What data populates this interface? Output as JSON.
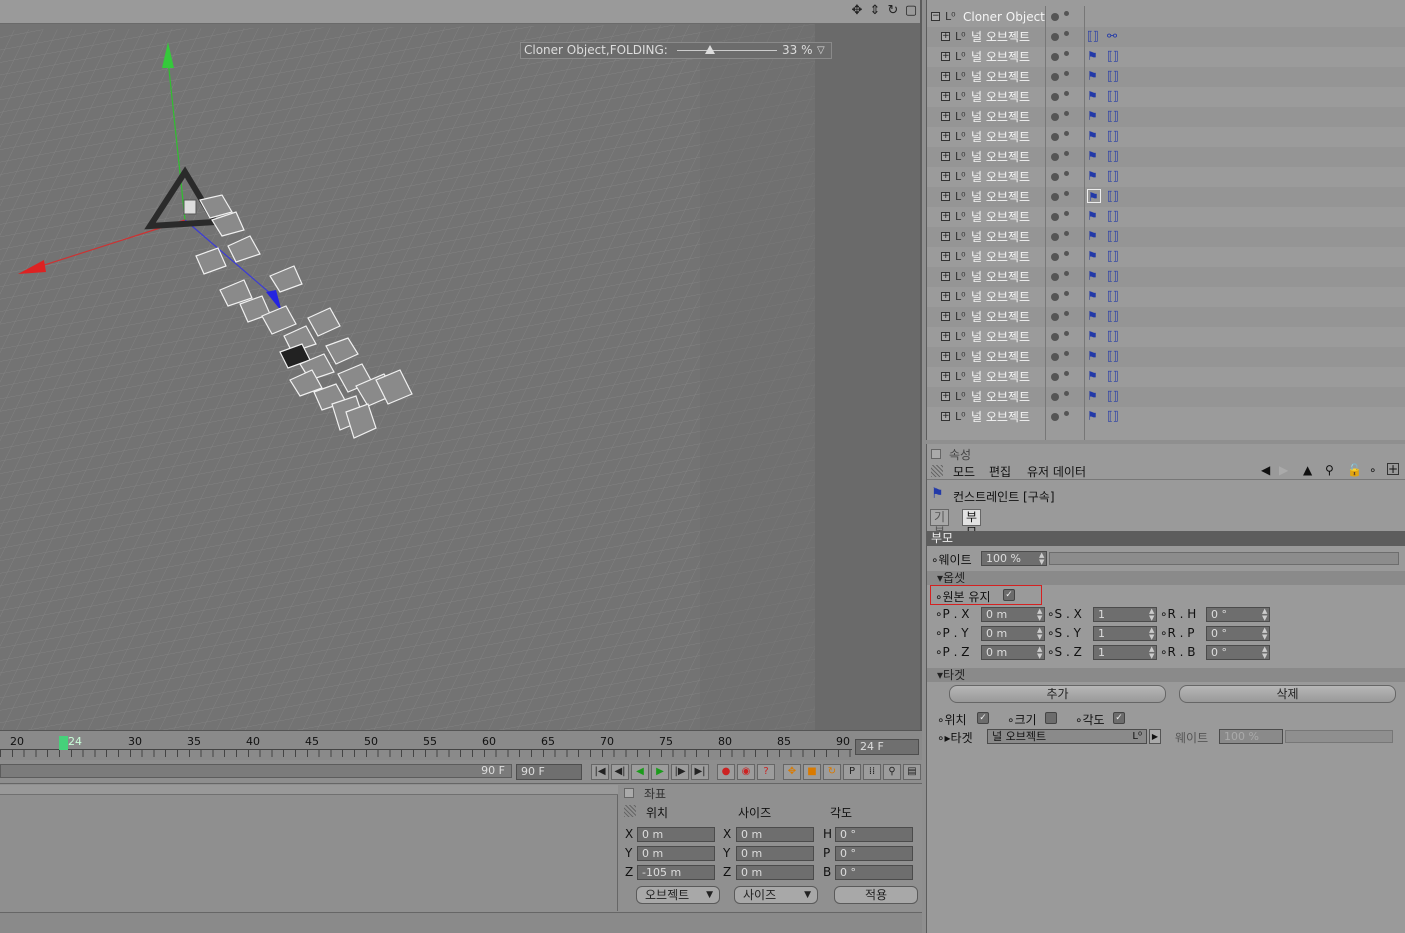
{
  "viewport": {
    "hud_label": "Cloner Object,FOLDING:",
    "hud_value": "33 %",
    "toolbar_icons": [
      "move-view-icon",
      "pan-view-icon",
      "rotate-view-icon",
      "maximize-view-icon"
    ]
  },
  "timeline": {
    "ticks": [
      "20",
      "24",
      "30",
      "35",
      "40",
      "45",
      "50",
      "55",
      "60",
      "65",
      "70",
      "75",
      "80",
      "85",
      "90"
    ],
    "fps": "24 F",
    "range_end_label": "90 F",
    "end_frame": "90 F",
    "current_frame": 24
  },
  "coords": {
    "title": "좌표",
    "headers": {
      "position": "위치",
      "size": "사이즈",
      "rotation": "각도"
    },
    "rows": [
      {
        "axis": "X",
        "pos": "0 m",
        "size_axis": "X",
        "size": "0 m",
        "rot_axis": "H",
        "rot": "0 °"
      },
      {
        "axis": "Y",
        "pos": "0 m",
        "size_axis": "Y",
        "size": "0 m",
        "rot_axis": "P",
        "rot": "0 °"
      },
      {
        "axis": "Z",
        "pos": "-105 m",
        "size_axis": "Z",
        "size": "0 m",
        "rot_axis": "B",
        "rot": "0 °"
      }
    ],
    "mode_dropdown": "오브젝트",
    "size_dropdown": "사이즈",
    "apply_button": "적용"
  },
  "objmgr": {
    "root_name": "Cloner Object",
    "child_name": "널 오브젝트",
    "child_count": 20
  },
  "attr": {
    "title": "속성",
    "menu": [
      "모드",
      "편집",
      "유저 데이터"
    ],
    "object_label": "컨스트레인트 [구속]",
    "tabs": [
      "기본",
      "부모"
    ],
    "section": "부모",
    "weight_label": "웨이트",
    "weight_value": "100 %",
    "offset_header": "옵셋",
    "keep_original": "원본 유지",
    "offset_rows": [
      {
        "p_label": "P . X",
        "p": "0 m",
        "s_label": "S . X",
        "s": "1",
        "r_label": "R . H",
        "r": "0 °"
      },
      {
        "p_label": "P . Y",
        "p": "0 m",
        "s_label": "S . Y",
        "s": "1",
        "r_label": "R . P",
        "r": "0 °"
      },
      {
        "p_label": "P . Z",
        "p": "0 m",
        "s_label": "S . Z",
        "s": "1",
        "r_label": "R . B",
        "r": "0 °"
      }
    ],
    "target_header": "타겟",
    "add_button": "추가",
    "delete_button": "삭제",
    "pos_label": "위치",
    "size_label": "크기",
    "angle_label": "각도",
    "target_label": "타겟",
    "target_value": "널 오브젝트",
    "target_weight_label": "웨이트",
    "target_weight_value": "100 %"
  }
}
